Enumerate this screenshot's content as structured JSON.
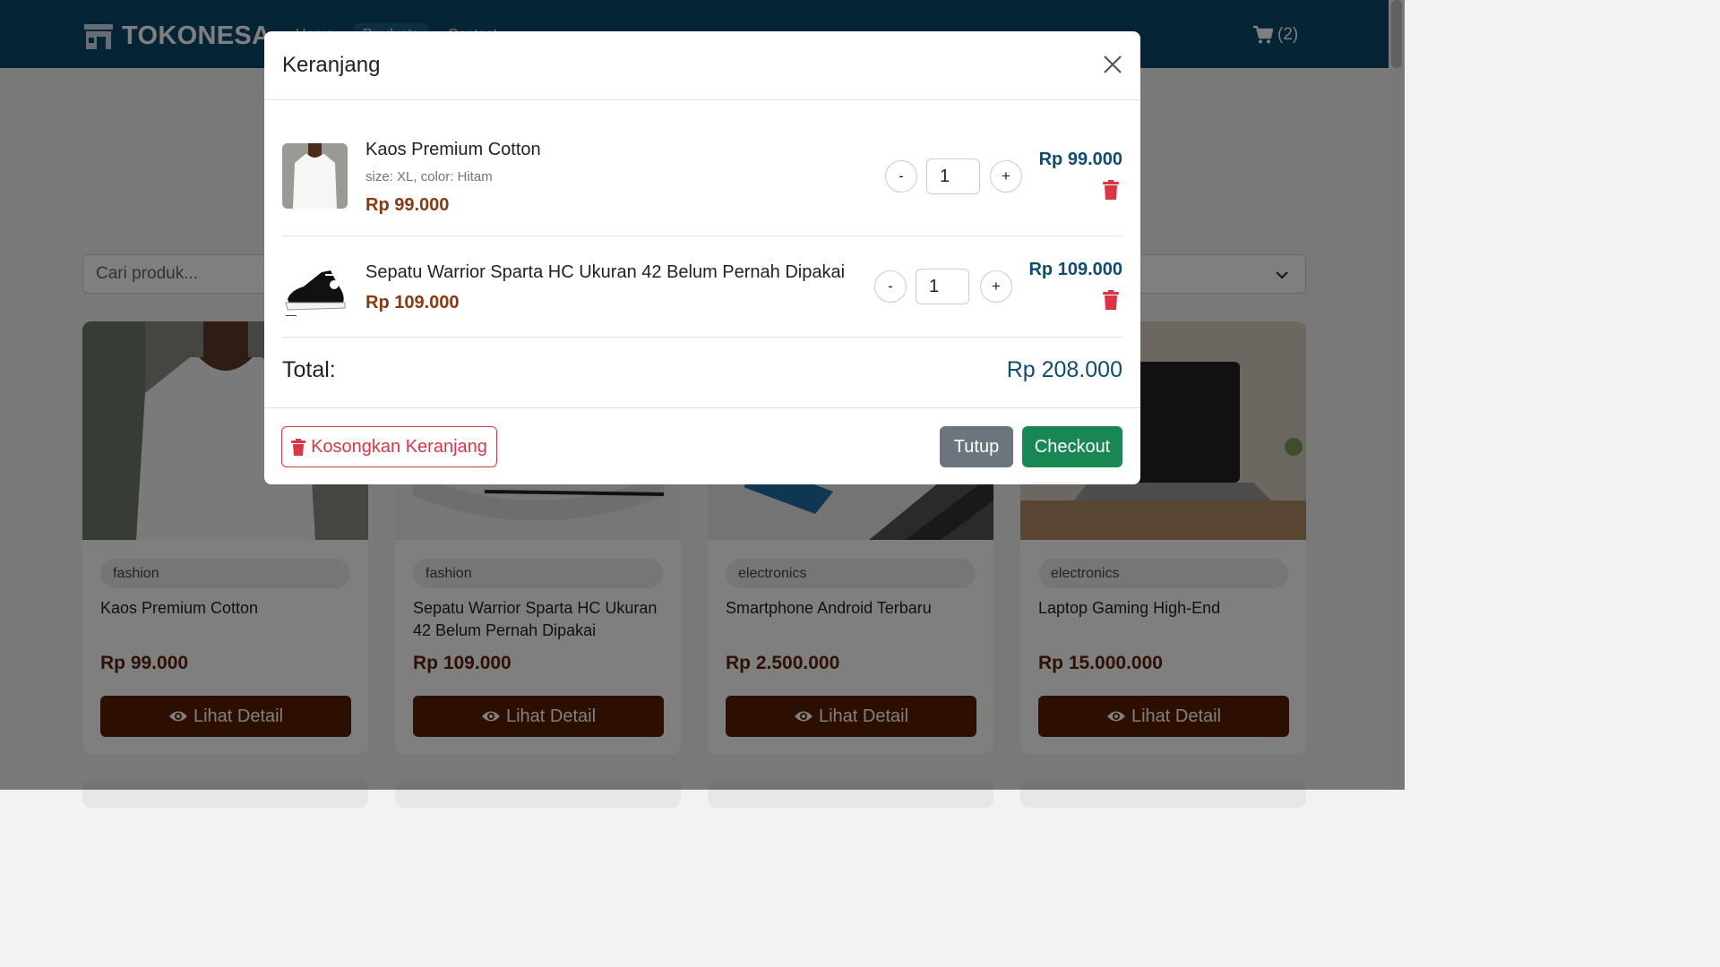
{
  "navbar": {
    "brand": "TOKONESA",
    "links": [
      "Home",
      "Products",
      "Contact"
    ],
    "cart_count": "(2)"
  },
  "search": {
    "placeholder": "Cari produk..."
  },
  "products": [
    {
      "category": "fashion",
      "name": "Kaos Premium Cotton",
      "price": "Rp 99.000",
      "button": "Lihat Detail"
    },
    {
      "category": "fashion",
      "name": "Sepatu Warrior Sparta HC Ukuran 42 Belum Pernah Dipakai",
      "price": "Rp 109.000",
      "button": "Lihat Detail"
    },
    {
      "category": "electronics",
      "name": "Smartphone Android Terbaru",
      "price": "Rp 2.500.000",
      "button": "Lihat Detail"
    },
    {
      "category": "electronics",
      "name": "Laptop Gaming High-End",
      "price": "Rp 15.000.000",
      "button": "Lihat Detail"
    }
  ],
  "modal": {
    "title": "Keranjang",
    "items": [
      {
        "name": "Kaos Premium Cotton",
        "variant": "size: XL, color: Hitam",
        "price": "Rp 99.000",
        "quantity": "1",
        "subtotal": "Rp 99.000"
      },
      {
        "name": "Sepatu Warrior Sparta HC Ukuran 42 Belum Pernah Dipakai",
        "price": "Rp 109.000",
        "quantity": "1",
        "subtotal": "Rp 109.000"
      }
    ],
    "qty_minus": "-",
    "qty_plus": "+",
    "total_label": "Total:",
    "total_value": "Rp 208.000",
    "empty_cart_label": "Kosongkan Keranjang",
    "close_label": "Tutup",
    "checkout_label": "Checkout"
  },
  "colors": {
    "navbar": "#0a4a6e",
    "price_brown": "#5c2208",
    "detail_button": "#5a1f05",
    "danger": "#dc3545",
    "success": "#198754",
    "secondary": "#6c757d",
    "subtotal_blue": "#0f4c75"
  },
  "icons": {
    "brand": "store-icon",
    "cart": "shopping-cart-icon",
    "detail": "eye-icon",
    "trash": "trash-icon",
    "close": "close-icon",
    "select": "chevron-down-icon"
  }
}
